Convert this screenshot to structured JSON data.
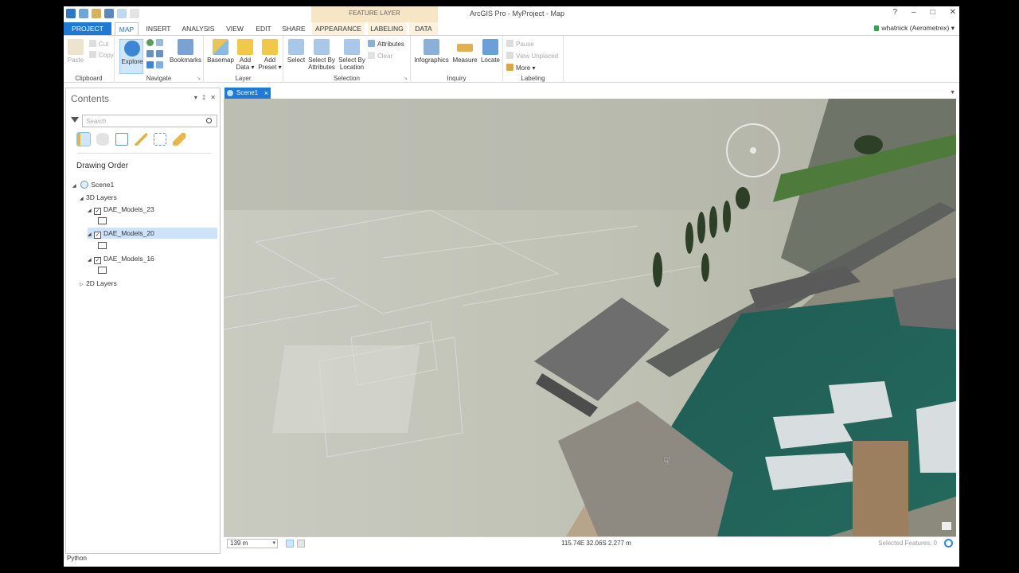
{
  "window": {
    "title": "ArcGIS Pro - MyProject - Map",
    "context_tab": "FEATURE LAYER",
    "controls": [
      "?",
      "–",
      "□",
      "✕"
    ]
  },
  "tabs": [
    "PROJECT",
    "MAP",
    "INSERT",
    "ANALYSIS",
    "VIEW",
    "EDIT",
    "SHARE",
    "APPEARANCE",
    "LABELING",
    "DATA"
  ],
  "user": "whatnick (Aerometrex) ▾",
  "ribbon": {
    "clipboard": {
      "label": "Clipboard",
      "paste": "Paste",
      "cut": "Cut",
      "copy": "Copy"
    },
    "navigate": {
      "label": "Navigate",
      "explore": "Explore",
      "bookmarks": "Bookmarks"
    },
    "layer": {
      "label": "Layer",
      "basemap": "Basemap",
      "add_data": "Add",
      "add_data2": "Data ▾",
      "add_preset": "Add",
      "add_preset2": "Preset ▾"
    },
    "selection": {
      "label": "Selection",
      "select": "Select",
      "select_by_attributes": "Select By",
      "select_by_attributes2": "Attributes",
      "select_by_location": "Select By",
      "select_by_location2": "Location",
      "attributes": "Attributes",
      "clear": "Clear"
    },
    "inquiry": {
      "label": "Inquiry",
      "infographics": "Infographics",
      "measure": "Measure",
      "locate": "Locate"
    },
    "labeling": {
      "label": "Labeling",
      "pause": "Pause",
      "view_unplaced": "View Unplaced",
      "more": "More ▾"
    }
  },
  "contents": {
    "title": "Contents",
    "search_placeholder": "Search",
    "section": "Drawing Order",
    "scene": "Scene1",
    "layers3d": "3D Layers",
    "models": [
      "DAE_Models_23",
      "DAE_Models_20",
      "DAE_Models_16"
    ],
    "layers2d": "2D Layers"
  },
  "view": {
    "tab": "Scene1"
  },
  "status": {
    "scale": "139 m",
    "coords": "115.74E 32.06S  2.277 m",
    "selected": "Selected Features: 0"
  },
  "python": "Python",
  "colors": {
    "accent": "#1f7ad3",
    "context": "#f6e6c6",
    "selection": "#cde3fa"
  }
}
